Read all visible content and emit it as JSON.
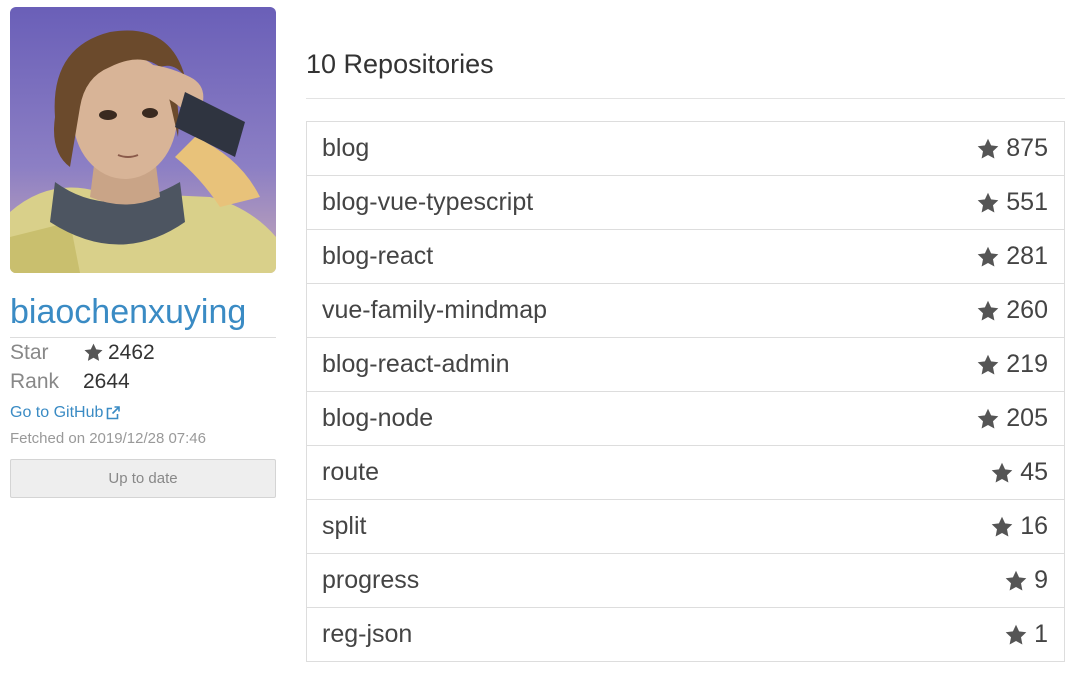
{
  "profile": {
    "username": "biaochenxuying",
    "star_label": "Star",
    "star_value": "2462",
    "rank_label": "Rank",
    "rank_value": "2644",
    "github_link_label": "Go to GitHub",
    "fetched_text": "Fetched on 2019/12/28 07:46",
    "update_button_label": "Up to date"
  },
  "repos": {
    "title": "10 Repositories",
    "items": [
      {
        "name": "blog",
        "stars": "875"
      },
      {
        "name": "blog-vue-typescript",
        "stars": "551"
      },
      {
        "name": "blog-react",
        "stars": "281"
      },
      {
        "name": "vue-family-mindmap",
        "stars": "260"
      },
      {
        "name": "blog-react-admin",
        "stars": "219"
      },
      {
        "name": "blog-node",
        "stars": "205"
      },
      {
        "name": "route",
        "stars": "45"
      },
      {
        "name": "split",
        "stars": "16"
      },
      {
        "name": "progress",
        "stars": "9"
      },
      {
        "name": "reg-json",
        "stars": "1"
      }
    ]
  },
  "icons": {
    "star": "star-icon",
    "external_link": "external-link-icon"
  },
  "colors": {
    "link": "#3a8bc4",
    "text": "#333333",
    "muted": "#888888",
    "border": "#dddddd"
  }
}
